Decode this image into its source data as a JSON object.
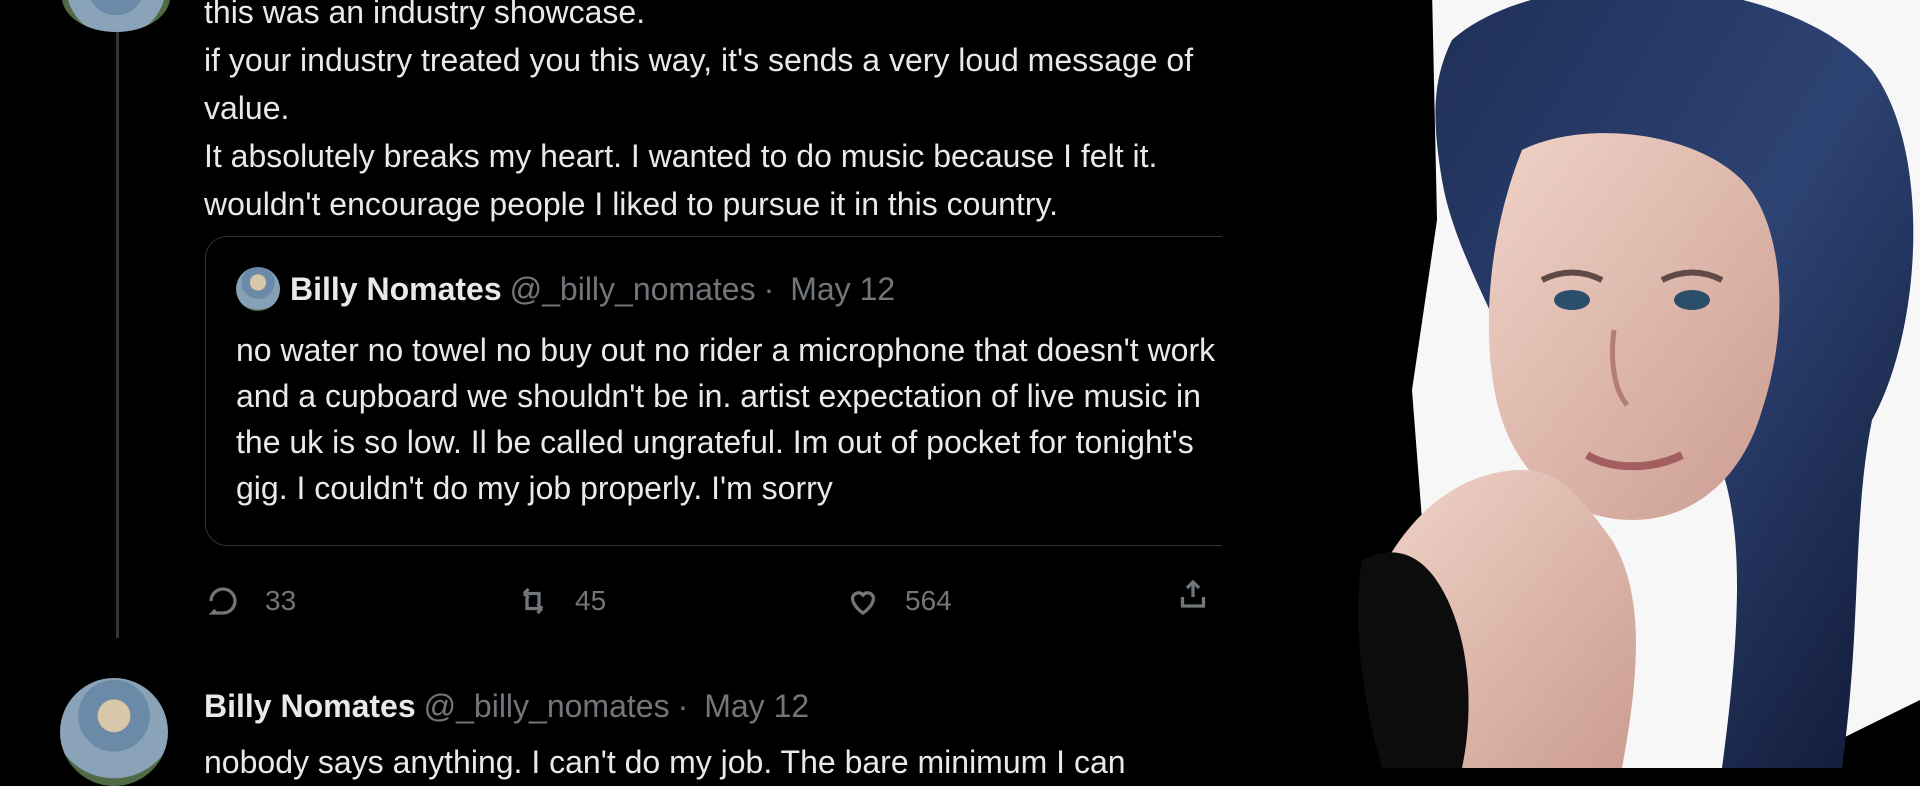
{
  "post": {
    "lines": [
      "this was an industry showcase.",
      "if your industry treated you this way, it's sends a very loud message of",
      "value.",
      "It absolutely breaks my heart. I wanted to do music because I felt it.",
      "wouldn't encourage people I liked to pursue it in this country."
    ]
  },
  "quote": {
    "name": "Billy Nomates",
    "handle": "@_billy_nomates",
    "date": "May 12",
    "lines": [
      "no water no towel no buy out no rider a microphone that doesn't work",
      "and a cupboard we shouldn't be in. artist expectation of live music in",
      "the uk is so low. Il be called ungrateful. Im out of pocket for tonight's",
      "gig. I couldn't do my job properly. I'm sorry"
    ]
  },
  "actions": {
    "replies": "33",
    "retweets": "45",
    "likes": "564"
  },
  "bottom_post": {
    "name": "Billy Nomates",
    "handle": "@_billy_nomates",
    "date": "May 12",
    "text": "nobody says anything. I can't do my job. The bare minimum I can"
  },
  "icons": {
    "reply": "reply-icon",
    "retweet": "retweet-icon",
    "like": "heart-icon",
    "share": "share-icon"
  },
  "colors": {
    "background": "#000000",
    "text": "#e7e9ea",
    "secondary": "#71767b",
    "border": "#2f3336"
  }
}
